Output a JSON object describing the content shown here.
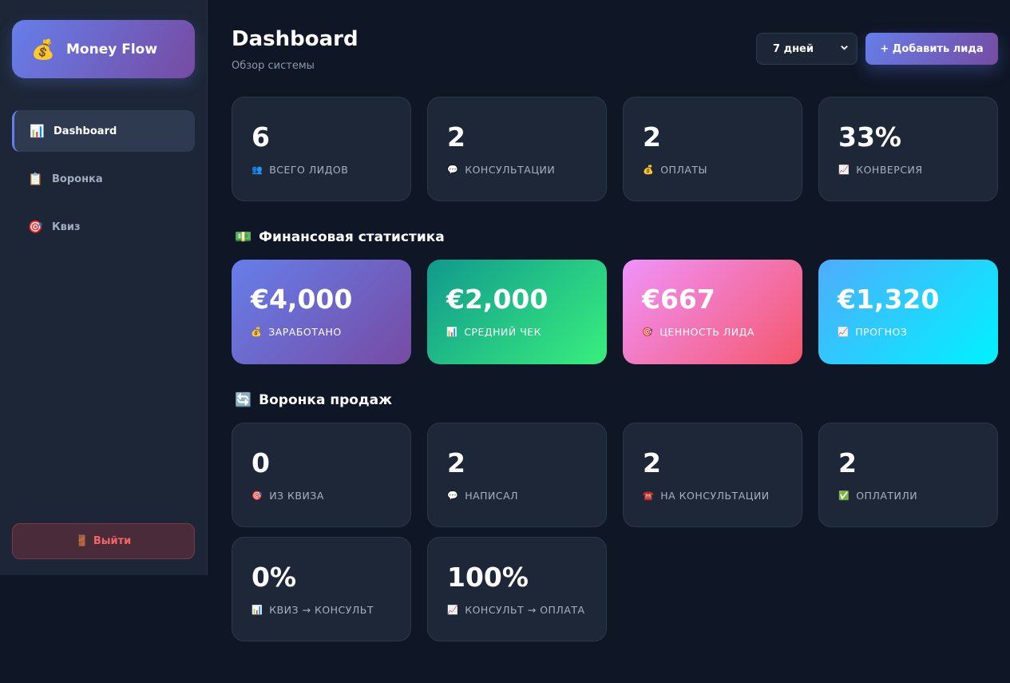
{
  "sidebar": {
    "brand": {
      "icon": "💰",
      "name": "Money Flow"
    },
    "items": [
      {
        "icon": "📊",
        "label": "Dashboard"
      },
      {
        "icon": "📋",
        "label": "Воронка"
      },
      {
        "icon": "🎯",
        "label": "Квиз"
      }
    ],
    "logout": {
      "icon": "🚪",
      "label": "Выйти"
    }
  },
  "header": {
    "title": "Dashboard",
    "subtitle": "Обзор системы",
    "period_selected": "7 дней",
    "add_button": "+ Добавить лида"
  },
  "overview": [
    {
      "value": "6",
      "icon": "👥",
      "label": "ВСЕГО ЛИДОВ"
    },
    {
      "value": "2",
      "icon": "💬",
      "label": "КОНСУЛЬТАЦИИ"
    },
    {
      "value": "2",
      "icon": "💰",
      "label": "ОПЛАТЫ"
    },
    {
      "value": "33%",
      "icon": "📈",
      "label": "КОНВЕРСИЯ"
    }
  ],
  "finance": {
    "icon": "💵",
    "title": "Финансовая статистика",
    "cards": [
      {
        "value": "€4,000",
        "icon": "💰",
        "label": "ЗАРАБОТАНО"
      },
      {
        "value": "€2,000",
        "icon": "📊",
        "label": "СРЕДНИЙ ЧЕК"
      },
      {
        "value": "€667",
        "icon": "🎯",
        "label": "ЦЕННОСТЬ ЛИДА"
      },
      {
        "value": "€1,320",
        "icon": "📈",
        "label": "ПРОГНОЗ"
      }
    ]
  },
  "funnel": {
    "icon": "🔄",
    "title": "Воронка продаж",
    "cards": [
      {
        "value": "0",
        "icon": "🎯",
        "label": "ИЗ КВИЗА"
      },
      {
        "value": "2",
        "icon": "💬",
        "label": "НАПИСАЛ"
      },
      {
        "value": "2",
        "icon": "☎️",
        "label": "НА КОНСУЛЬТАЦИИ"
      },
      {
        "value": "2",
        "icon": "✅",
        "label": "ОПЛАТИЛИ"
      },
      {
        "value": "0%",
        "icon": "📊",
        "label": "КВИЗ → КОНСУЛЬТ"
      },
      {
        "value": "100%",
        "icon": "📈",
        "label": "КОНСУЛЬТ → ОПЛАТА"
      }
    ]
  }
}
